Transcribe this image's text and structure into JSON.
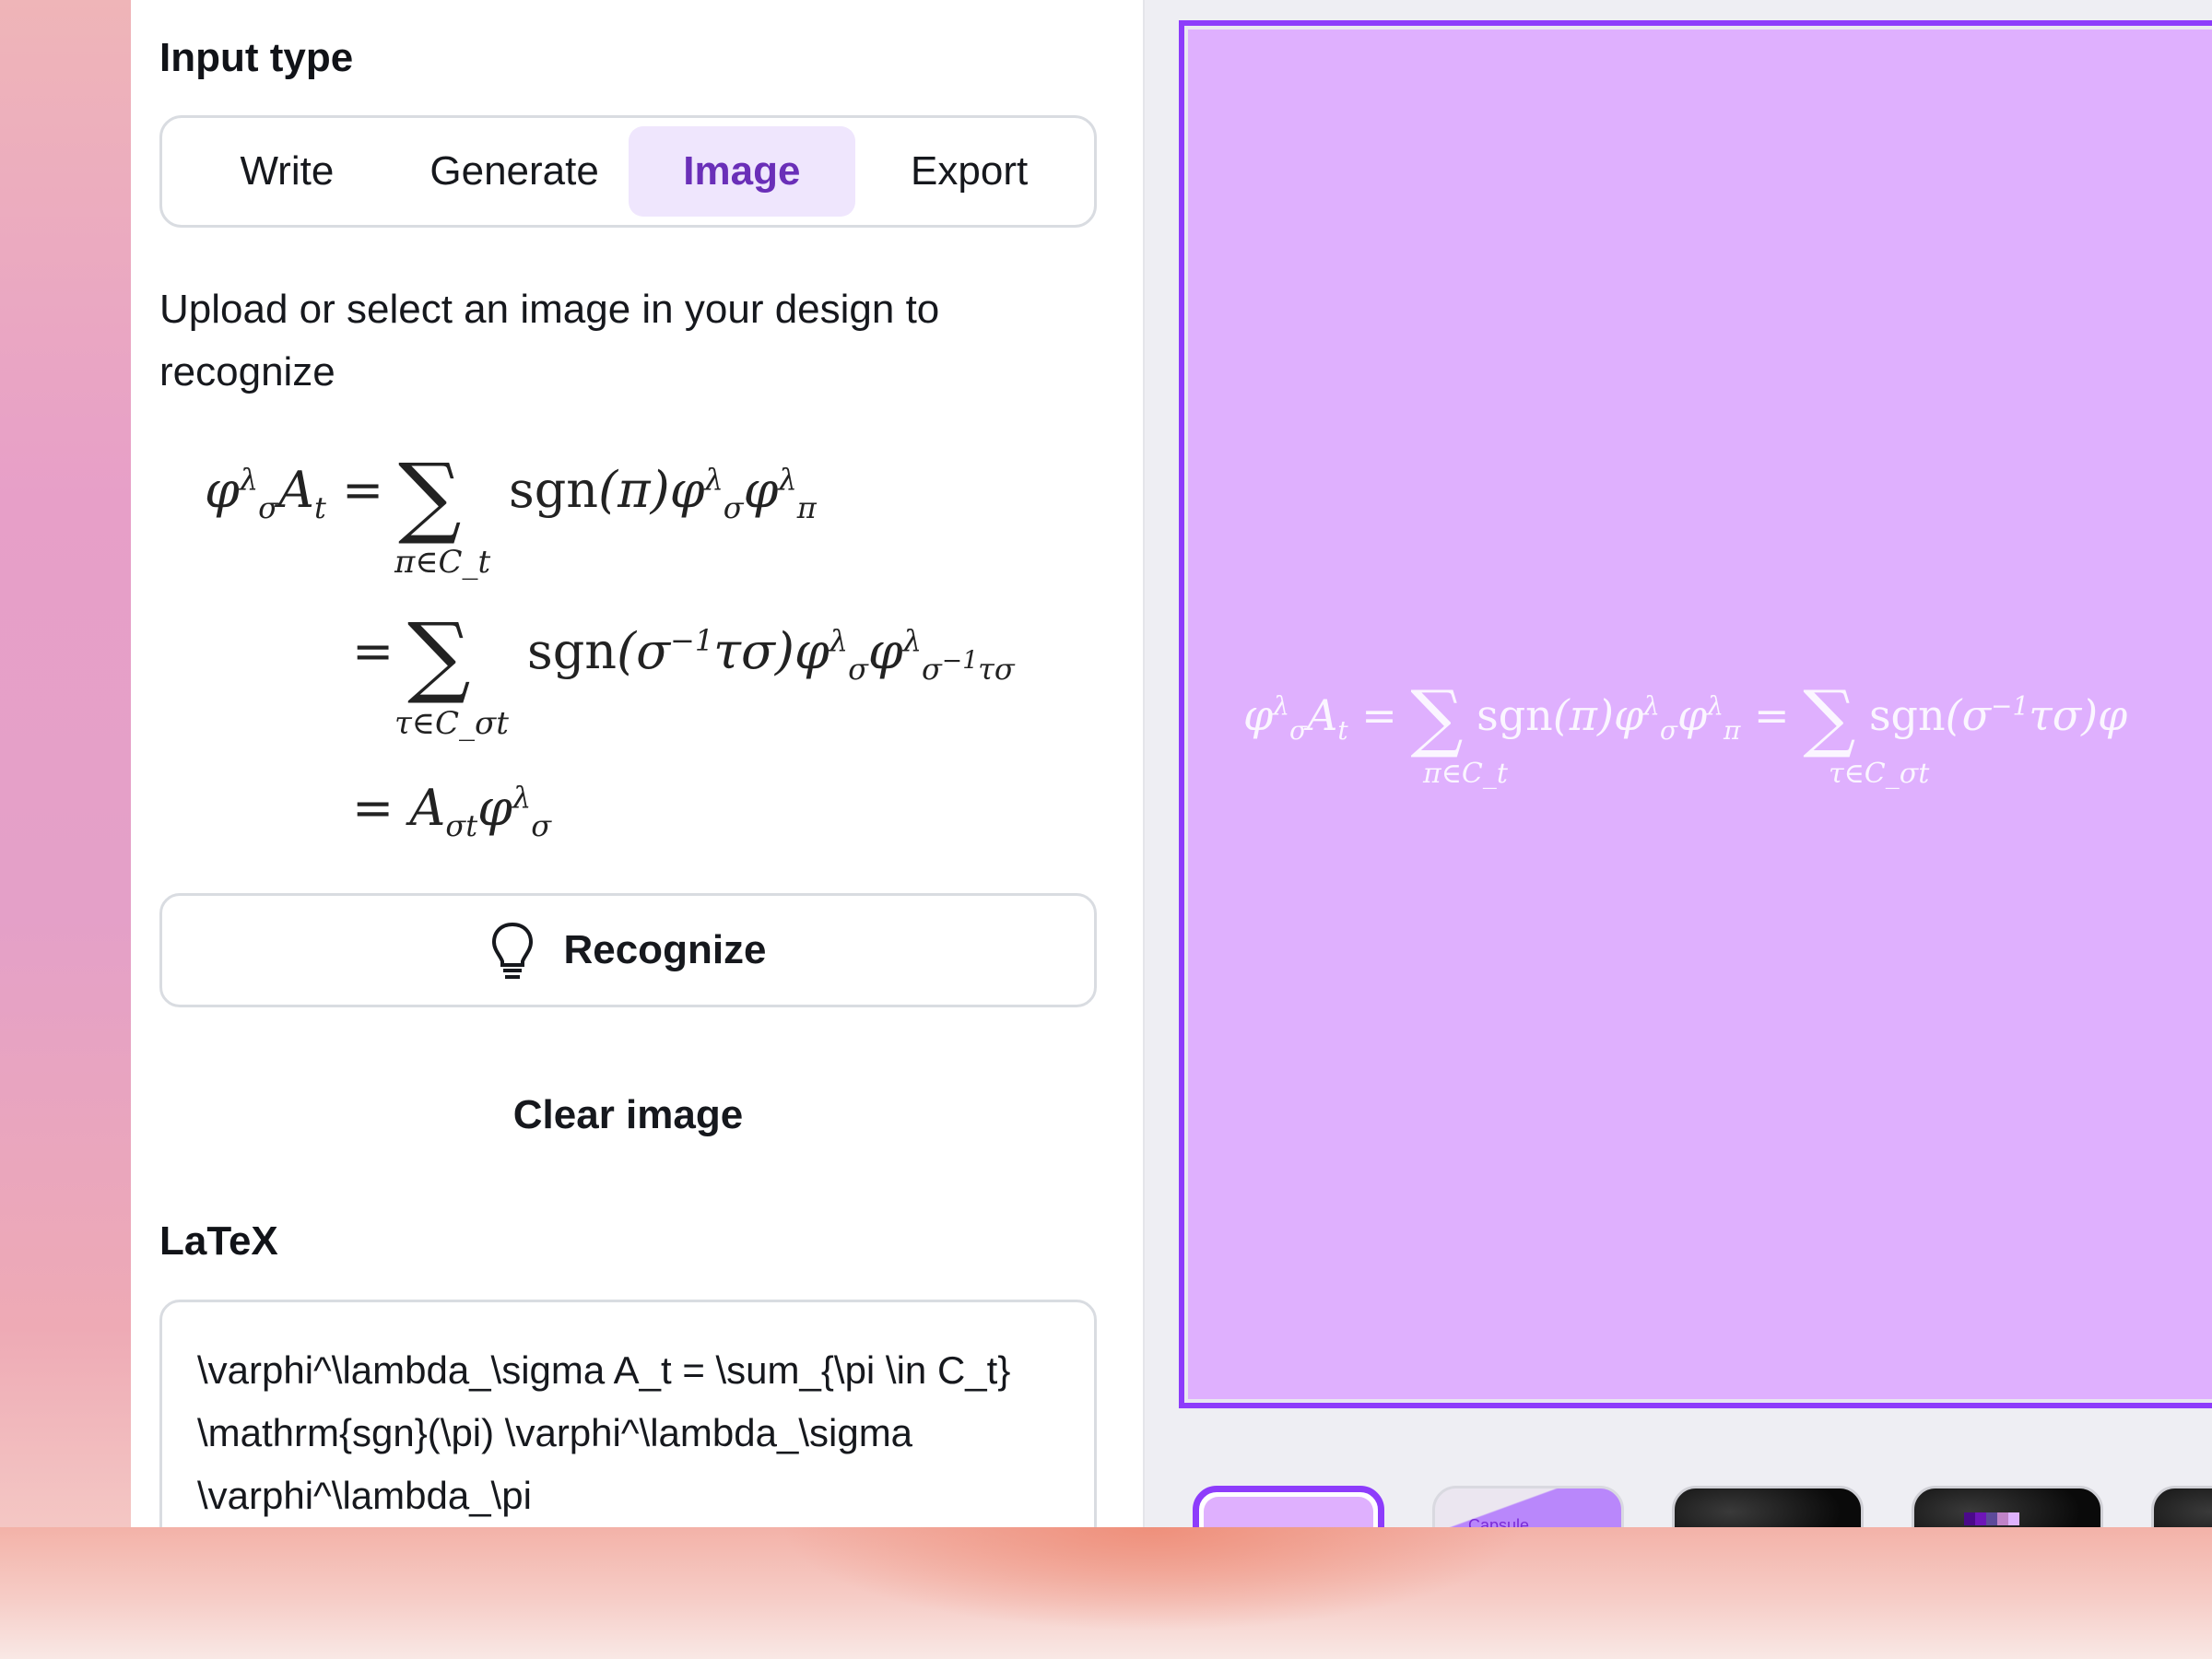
{
  "panel": {
    "input_type_label": "Input type",
    "tabs": [
      {
        "label": "Write",
        "active": false
      },
      {
        "label": "Generate",
        "active": false
      },
      {
        "label": "Image",
        "active": true
      },
      {
        "label": "Export",
        "active": false
      }
    ],
    "description": "Upload or select an image in your design to recognize",
    "preview_equation": {
      "line1": {
        "lhs": "φ^λ_σ A_t =",
        "operator": "∑",
        "sub": "π∈C_t",
        "rhs": "sgn(π)φ^λ_σ φ^λ_π"
      },
      "line2": {
        "lhs": "=",
        "operator": "∑",
        "sub": "τ∈C_σt",
        "rhs": "sgn(σ⁻¹τσ)φ^λ_σ φ^λ_σ⁻¹τσ"
      },
      "line3": {
        "lhs": "=",
        "rhs": "A_σt φ^λ_σ"
      }
    },
    "recognize_button": {
      "label": "Recognize",
      "icon": "lightbulb-icon"
    },
    "clear_button": {
      "label": "Clear image"
    },
    "latex_label": "LaTeX",
    "latex_value": "\\varphi^\\lambda_\\sigma A_t = \\sum_{\\pi \\in C_t} \\mathrm{sgn}(\\pi) \\varphi^\\lambda_\\sigma \\varphi^\\lambda_\\pi"
  },
  "canvas": {
    "equation_text": "φ^λ_σ A_t = ∑ sgn(π)φ^λ_σ φ^λ_π = ∑ sgn(σ⁻¹τσ)φ",
    "sub1": "π∈C_t",
    "sub2": "τ∈C_σt",
    "background_color": "#dfb0fe",
    "selection_color": "#8d3cfb"
  },
  "thumbnails": [
    {
      "name": "page-1",
      "selected": true
    },
    {
      "name": "page-2",
      "selected": false,
      "caption": "Capsule"
    },
    {
      "name": "page-3",
      "selected": false
    },
    {
      "name": "page-4",
      "selected": false
    },
    {
      "name": "page-5",
      "selected": false
    }
  ],
  "colors": {
    "accent": "#8d3cfb",
    "active_tab_bg": "#efe6fd",
    "active_tab_text": "#6a2fb8"
  }
}
